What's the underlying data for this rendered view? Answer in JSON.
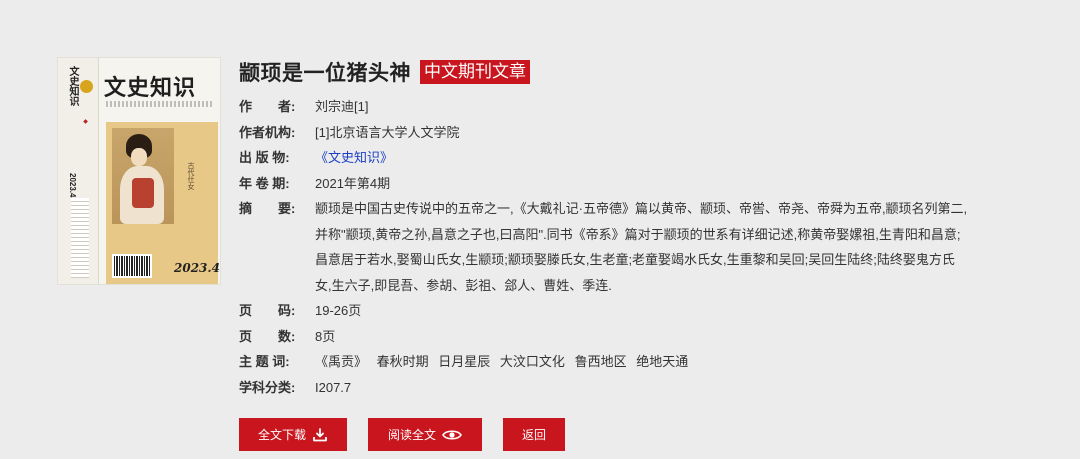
{
  "cover": {
    "title": "文史知识",
    "spine_title": "文史知识",
    "spine_year": "2023.4",
    "issue": "2023.4",
    "vertical_text": "古代仕女",
    "art_bg": "#e8c886"
  },
  "article": {
    "title": "颛顼是一位猪头神",
    "type_badge": "中文期刊文章"
  },
  "fields": {
    "author": {
      "label": "作　　者:",
      "value": "刘宗迪[1]"
    },
    "institution": {
      "label": "作者机构:",
      "value": "[1]北京语言大学人文学院"
    },
    "publication": {
      "label": "出 版 物:",
      "value": "《文史知识》"
    },
    "volume": {
      "label": "年 卷 期:",
      "value": "2021年第4期"
    },
    "abstract": {
      "label": "摘　　要:",
      "value": "颛顼是中国古史传说中的五帝之一,《大戴礼记·五帝德》篇以黄帝、颛顼、帝喾、帝尧、帝舜为五帝,颛顼名列第二,并称\"颛顼,黄帝之孙,昌意之子也,曰高阳\".同书《帝系》篇对于颛顼的世系有详细记述,称黄帝娶嫘祖,生青阳和昌意;昌意居于若水,娶蜀山氏女,生颛顼;颛顼娶滕氏女,生老童;老童娶竭水氏女,生重黎和吴回;吴回生陆终;陆终娶鬼方氏女,生六子,即昆吾、参胡、彭祖、郐人、曹姓、季连."
    },
    "pages": {
      "label": "页　　码:",
      "value": "19-26页"
    },
    "page_count": {
      "label": "页　　数:",
      "value": "8页"
    },
    "keywords": {
      "label": "主 题 词:",
      "items": [
        "《禹贡》",
        "春秋时期",
        "日月星辰",
        "大汶口文化",
        "鲁西地区",
        "绝地天通"
      ]
    },
    "classification": {
      "label": "学科分类:",
      "value": "I207.7"
    }
  },
  "actions": {
    "download": "全文下载",
    "read": "阅读全文",
    "back": "返回"
  },
  "colors": {
    "accent": "#c9151e",
    "link": "#1a3fc4",
    "background": "#ececec"
  }
}
